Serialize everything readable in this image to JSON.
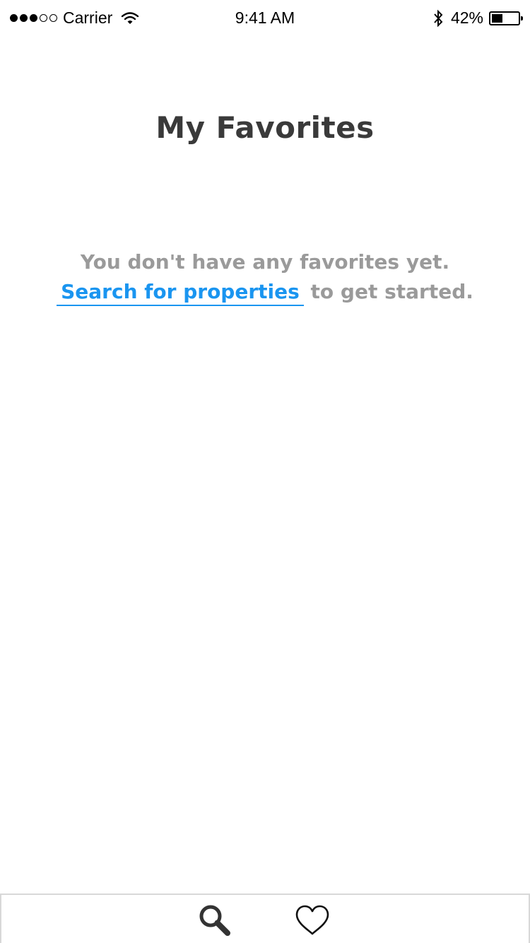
{
  "status_bar": {
    "carrier": "Carrier",
    "time": "9:41 AM",
    "battery_percent": "42%",
    "battery_level": 0.42,
    "signal_bars_filled": 3,
    "signal_bars_total": 5
  },
  "header": {
    "title": "My Favorites"
  },
  "empty_state": {
    "line1": "You don't have any favorites yet.",
    "link_label": "Search for properties",
    "suffix": " to get started."
  },
  "tab_bar": {
    "tabs": [
      {
        "icon": "search-icon"
      },
      {
        "icon": "heart-icon"
      }
    ]
  },
  "colors": {
    "title": "#3a3a3a",
    "muted_text": "#9a9a9a",
    "link": "#1a95f0",
    "divider": "#d8d8d8"
  }
}
